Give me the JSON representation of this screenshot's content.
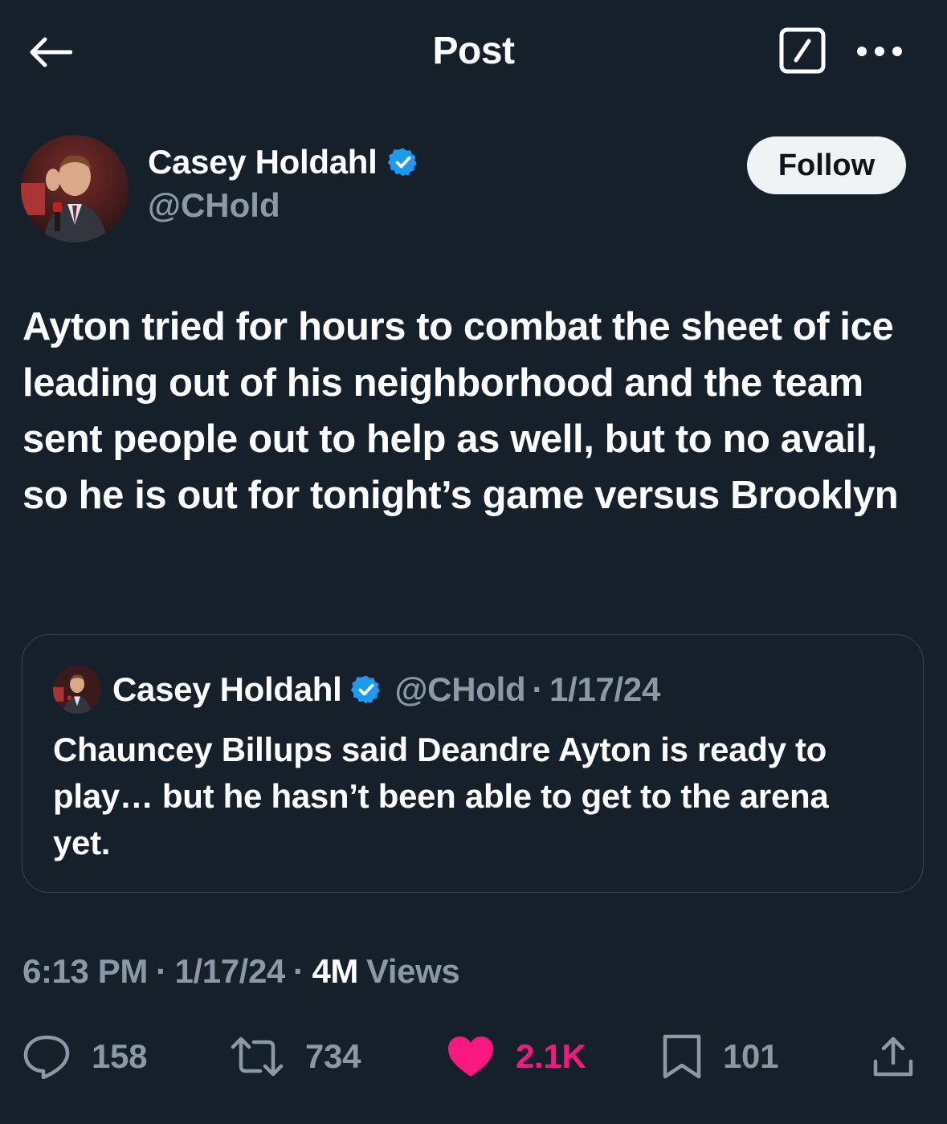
{
  "header": {
    "title": "Post",
    "back_icon": "arrow-left-icon",
    "compose_icon": "compose-slash-icon",
    "more_icon": "more-horizontal-icon"
  },
  "author": {
    "name": "Casey Holdahl",
    "handle": "@CHold",
    "verified": true,
    "follow_label": "Follow"
  },
  "tweet": {
    "text": "Ayton tried for hours to combat the sheet of ice leading out of his neighborhood and the team sent people out to help as well, but to no avail, so he is out for tonight’s game versus Brooklyn"
  },
  "quote": {
    "name": "Casey Holdahl",
    "handle": "@CHold",
    "dot": "·",
    "date": "1/17/24",
    "text": "Chauncey Billups said Deandre Ayton is ready to play… but he hasn’t been able to get to the arena yet."
  },
  "meta": {
    "time": "6:13 PM",
    "date": "1/17/24",
    "sep": "·",
    "views_count": "4M",
    "views_label": "Views"
  },
  "actions": {
    "replies": "158",
    "reposts": "734",
    "likes": "2.1K",
    "bookmarks": "101",
    "liked": true
  },
  "colors": {
    "background": "#15202b",
    "secondary_text": "#8b98a5",
    "verified_blue": "#1d9bf0",
    "like_pink": "#f91880",
    "border": "#38444d"
  }
}
